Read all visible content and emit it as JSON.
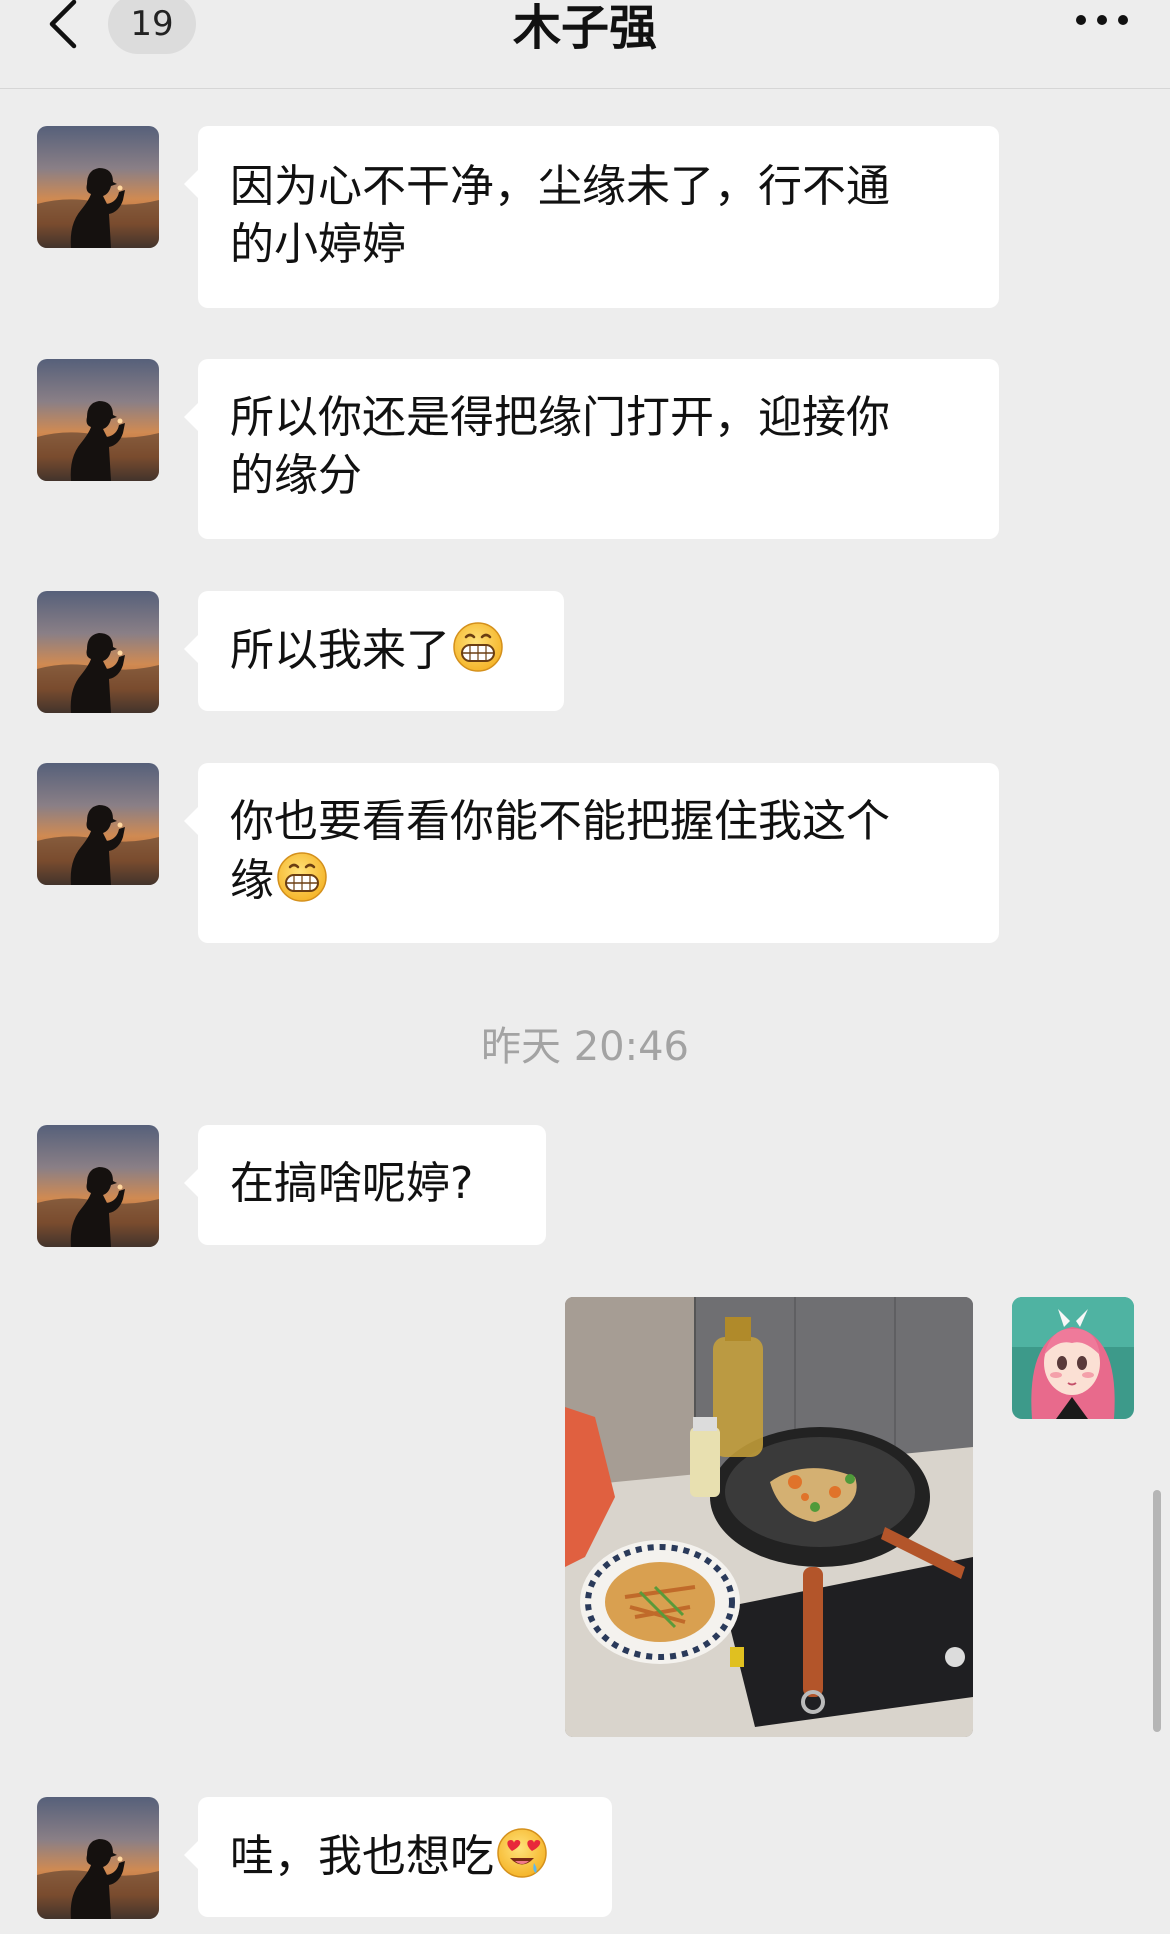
{
  "header": {
    "back_icon": "chevron-left-icon",
    "unread_count": "19",
    "title": "木子强",
    "more_icon": "more-dots-icon"
  },
  "messages": [
    {
      "side": "left",
      "text": "因为心不干净，尘缘未了，行不通的小婷婷",
      "line1": "因为心不干净，尘缘未了，行不通",
      "line2": "的小婷婷"
    },
    {
      "side": "left",
      "text": "所以你还是得把缘门打开，迎接你的缘分",
      "line1": "所以你还是得把缘门打开，迎接你",
      "line2": "的缘分"
    },
    {
      "side": "left",
      "text": "所以我来了",
      "emoji": "grin-emoji"
    },
    {
      "side": "left",
      "text": "你也要看看你能不能把握住我这个缘",
      "line1": "你也要看看你能不能把握住我这个",
      "line2": "缘",
      "emoji": "grin-emoji"
    },
    {
      "side": "left",
      "text": "在搞啥呢婷?"
    },
    {
      "side": "right",
      "type": "image",
      "image_desc": "cooking-photo"
    },
    {
      "side": "left",
      "text": "哇，我也想吃",
      "emoji": "heart-eyes-emoji"
    }
  ],
  "timestamp": "昨天 20:46",
  "colors": {
    "background": "#ededed",
    "bubble": "#ffffff",
    "timestamp": "#a3a3a3"
  }
}
